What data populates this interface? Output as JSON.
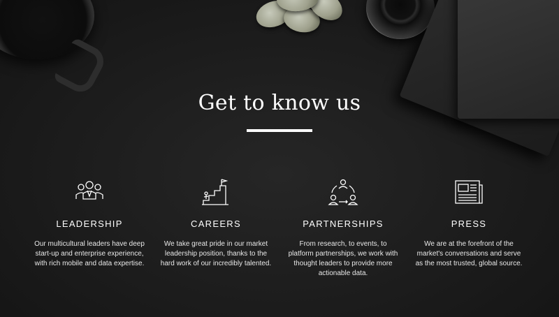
{
  "section": {
    "title": "Get to know us"
  },
  "features": [
    {
      "icon": "team-icon",
      "heading": "LEADERSHIP",
      "description": "Our multicultural leaders have deep start-up and enterprise experience, with rich mobile and data expertise."
    },
    {
      "icon": "career-stairs-icon",
      "heading": "CAREERS",
      "description": "We take great pride in our market leadership position, thanks to the hard work of our incredibly talented."
    },
    {
      "icon": "partnership-cycle-icon",
      "heading": "PARTNERSHIPS",
      "description": "From research, to events, to platform partnerships, we work with thought leaders to provide more actionable data."
    },
    {
      "icon": "newspaper-icon",
      "heading": "PRESS",
      "description": "We are at the forefront of the market's conversations and serve as the most trusted, global source."
    }
  ]
}
